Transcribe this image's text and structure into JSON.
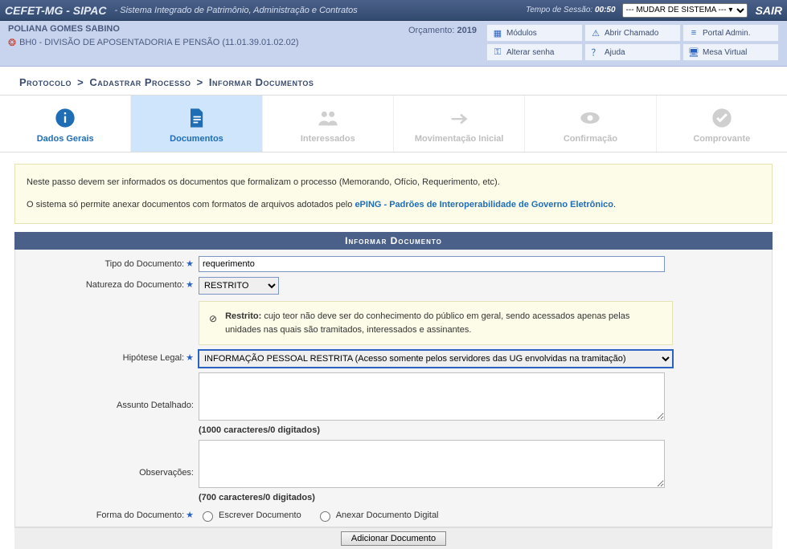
{
  "top": {
    "brand": "CEFET-MG - SIPAC",
    "subtitle": "- Sistema Integrado de Patrimônio, Administração e Contratos",
    "session_label": "Tempo de Sessão:",
    "session_time": "00:50",
    "system_select": "--- MUDAR DE SISTEMA --- ▾",
    "sair": "SAIR"
  },
  "user": {
    "name": "POLIANA GOMES SABINO",
    "unit": "BH0 - DIVISÃO DE APOSENTADORIA E PENSÃO (11.01.39.01.02.02)",
    "orc_label": "Orçamento:",
    "orc_year": "2019"
  },
  "links": {
    "modulos": "Módulos",
    "abrir": "Abrir Chamado",
    "portal": "Portal Admin.",
    "alterar": "Alterar senha",
    "ajuda": "Ajuda",
    "mesa": "Mesa Virtual"
  },
  "breadcrumb": {
    "a": "Protocolo",
    "b": "Cadastrar Processo",
    "c": "Informar Documentos"
  },
  "steps": {
    "dados": "Dados Gerais",
    "documentos": "Documentos",
    "interessados": "Interessados",
    "mov": "Movimentação Inicial",
    "conf": "Confirmação",
    "comp": "Comprovante"
  },
  "info": {
    "line1": "Neste passo devem ser informados os documentos que formalizam o processo (Memorando, Ofício, Requerimento, etc).",
    "line2a": "O sistema só permite anexar documentos com formatos de arquivos adotados pelo ",
    "eping": "ePING - Padrões de Interoperabilidade de Governo Eletrônico",
    "line2b": "."
  },
  "form": {
    "title": "Informar Documento",
    "tipo_label": "Tipo do Documento:",
    "tipo_value": "requerimento",
    "natureza_label": "Natureza do Documento:",
    "natureza_value": "RESTRITO",
    "restrito_bold": "Restrito:",
    "restrito_text": " cujo teor não deve ser do conhecimento do público em geral, sendo acessados apenas pelas unidades nas quais são tramitados, interessados e assinantes.",
    "hipotese_label": "Hipótese Legal:",
    "hipotese_value": "INFORMAÇÃO PESSOAL RESTRITA (Acesso somente pelos servidores das UG envolvidas na tramitação)",
    "assunto_label": "Assunto Detalhado:",
    "assunto_counter": "(1000 caracteres/0 digitados)",
    "obs_label": "Observações:",
    "obs_counter": "(700 caracteres/0 digitados)",
    "forma_label": "Forma do Documento:",
    "forma_escrever": "Escrever Documento",
    "forma_anexar": "Anexar Documento Digital",
    "add_btn": "Adicionar Documento"
  }
}
